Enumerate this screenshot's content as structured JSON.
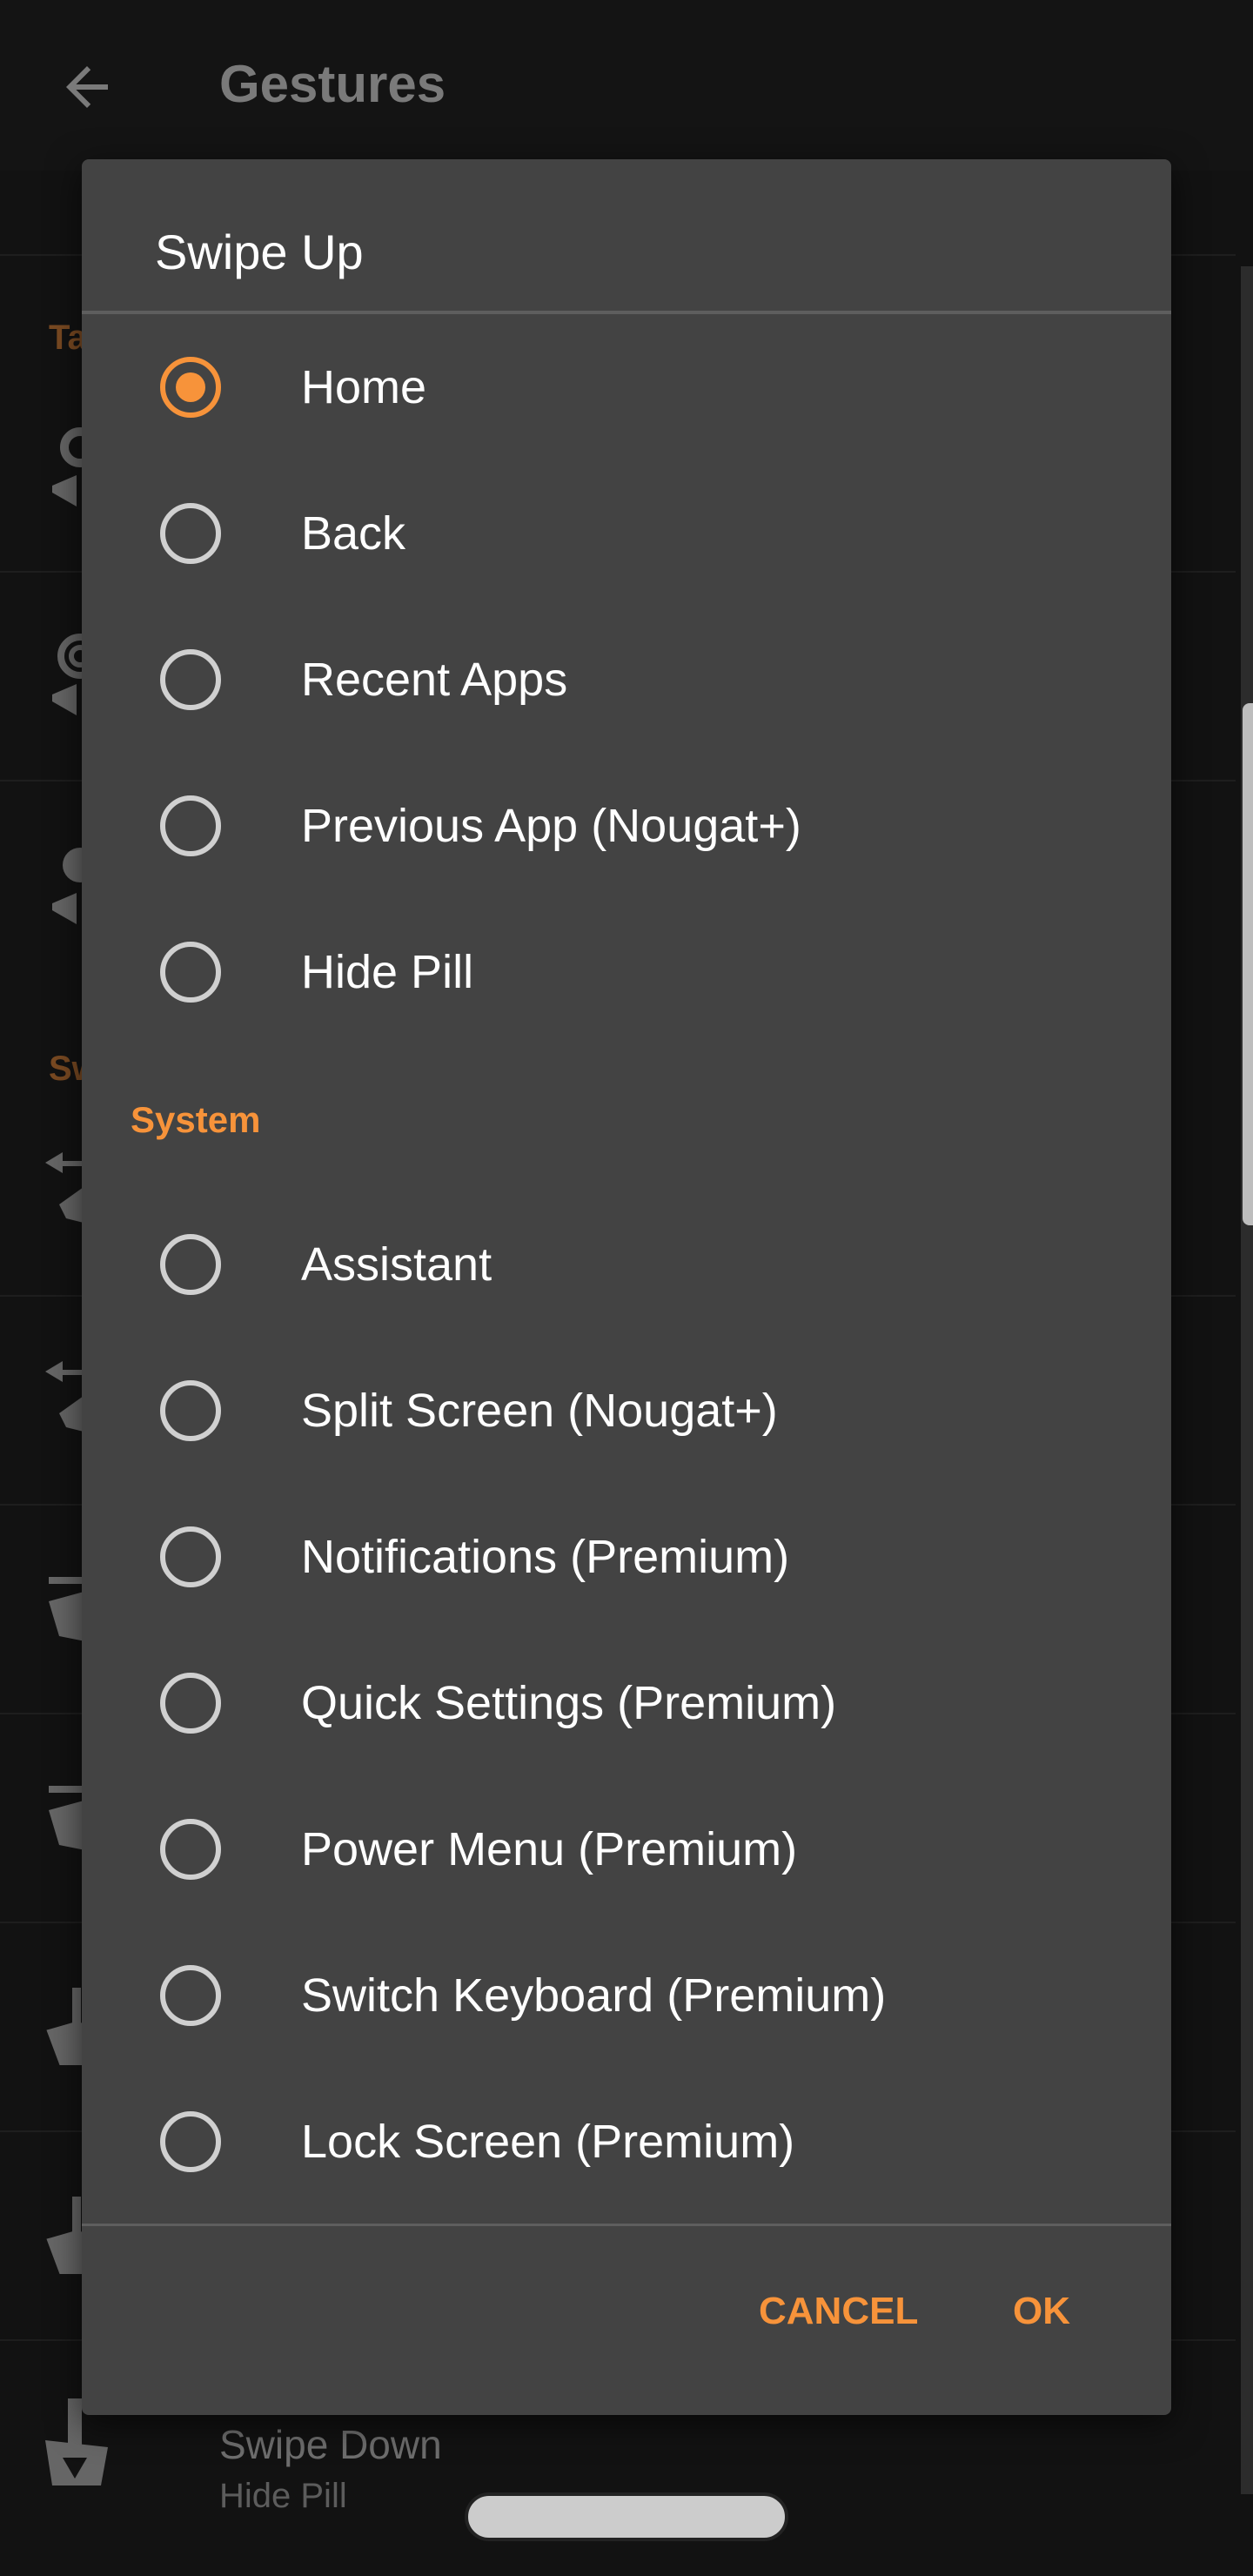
{
  "appbar": {
    "title": "Gestures",
    "back_icon": "arrow-left-icon"
  },
  "background": {
    "section_headers": [
      "Ta",
      "Sw"
    ],
    "visible_row": {
      "label": "Swipe Down",
      "value": "Hide Pill"
    }
  },
  "dialog": {
    "title": "Swipe Up",
    "options_top": [
      {
        "label": "Home",
        "selected": true
      },
      {
        "label": "Back",
        "selected": false
      },
      {
        "label": "Recent Apps",
        "selected": false
      },
      {
        "label": "Previous App (Nougat+)",
        "selected": false
      },
      {
        "label": "Hide Pill",
        "selected": false
      }
    ],
    "section_label": "System",
    "options_system": [
      {
        "label": "Assistant",
        "selected": false
      },
      {
        "label": "Split Screen (Nougat+)",
        "selected": false
      },
      {
        "label": "Notifications (Premium)",
        "selected": false
      },
      {
        "label": "Quick Settings (Premium)",
        "selected": false
      },
      {
        "label": "Power Menu (Premium)",
        "selected": false
      },
      {
        "label": "Switch Keyboard (Premium)",
        "selected": false
      },
      {
        "label": "Lock Screen (Premium)",
        "selected": false
      }
    ],
    "cancel_label": "CANCEL",
    "ok_label": "OK"
  },
  "colors": {
    "accent": "#f7933a",
    "dialog_bg": "#434343",
    "app_bg": "#121212"
  }
}
